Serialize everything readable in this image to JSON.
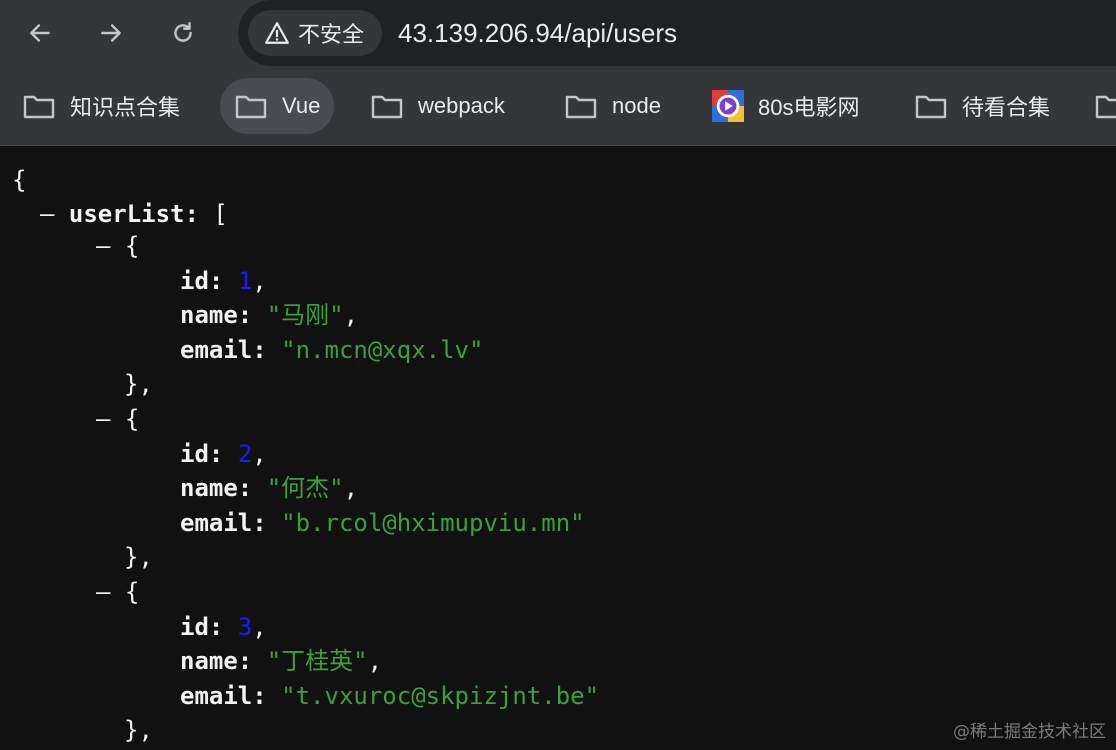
{
  "toolbar": {
    "security_label": "不安全",
    "url": "43.139.206.94/api/users"
  },
  "bookmarks": [
    {
      "label": "知识点合集",
      "icon": "folder-icon"
    },
    {
      "label": "Vue",
      "icon": "folder-icon"
    },
    {
      "label": "webpack",
      "icon": "folder-icon"
    },
    {
      "label": "node",
      "icon": "folder-icon"
    },
    {
      "label": "80s电影网",
      "icon": "play-favicon-icon"
    },
    {
      "label": "待看合集",
      "icon": "folder-icon"
    }
  ],
  "json_view": {
    "open_brace": "{",
    "collapse_marker": "–",
    "root_key": "userList",
    "array_open": "[",
    "field_keys": {
      "id": "id",
      "name": "name",
      "email": "email"
    },
    "users": [
      {
        "id": "1",
        "name": "\"马刚\"",
        "email": "\"n.mcn@xqx.lv\""
      },
      {
        "id": "2",
        "name": "\"何杰\"",
        "email": "\"b.rcol@hximupviu.mn\""
      },
      {
        "id": "3",
        "name": "\"丁桂英\"",
        "email": "\"t.vxuroc@skpizjnt.be\""
      }
    ]
  },
  "watermark": "@稀土掘金技术社区",
  "colors": {
    "toolbar_bg": "#35363a",
    "omnibox_bg": "#202124",
    "page_bg": "#111111",
    "number": "#1a1aff",
    "string": "#3aa13a"
  }
}
